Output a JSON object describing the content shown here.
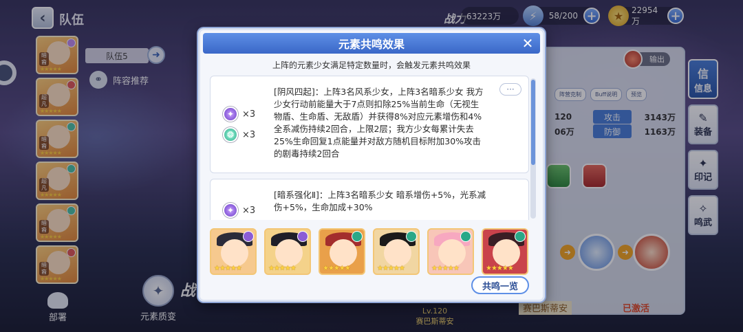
{
  "header": {
    "title": "队伍",
    "power_label": "战力",
    "power_value": "63223万",
    "energy": "58/200",
    "gold": "22954万"
  },
  "team": {
    "name": "队伍5",
    "lineup_recommend": "阵容推荐",
    "element_change": "元素质变",
    "battle": "战",
    "deploy": "部署"
  },
  "roster": [
    {
      "role": "暗裔",
      "color": "#c18cf0"
    },
    {
      "role": "超凡",
      "color": "#e05a5a"
    },
    {
      "role": "暗裔",
      "color": "#4fc3a6"
    },
    {
      "role": "超凡",
      "color": "#4fc3a6"
    },
    {
      "role": "暗裔",
      "color": "#4fc3a6"
    },
    {
      "role": "暗裔",
      "color": "#e05a5a"
    }
  ],
  "modal": {
    "title": "元素共鸣效果",
    "close": "✕",
    "subtitle": "上阵的元素少女满足特定数量时，会触发元素共鸣效果",
    "more": "···",
    "cards": [
      {
        "reqs": [
          {
            "elem": "dark",
            "count": "×3"
          },
          {
            "elem": "wind",
            "count": "×3"
          }
        ],
        "text": "[阴风四起]：上阵3名风系少女，上阵3名暗系少女 我方少女行动前能量大于7点则扣除25%当前生命（无视生物盾、生命盾、无敌盾）并获得8%对应元素增伤和4%全系减伤持续2回合，上限2层；我方少女每累计失去25%生命回复1点能量并对敌方随机目标附加30%攻击的剧毒持续2回合"
      },
      {
        "reqs": [
          {
            "elem": "dark",
            "count": "×3"
          }
        ],
        "text": "[暗系强化Ⅱ]：上阵3名暗系少女 暗系增伤+5%，光系减伤+5%，生命加成+30%"
      }
    ],
    "resonance_button": "共鸣一览"
  },
  "lineup": [
    {
      "el": "dark",
      "hat": "#2b2b3a",
      "bg": "#f6c98e"
    },
    {
      "el": "dark",
      "hat": "#1e1e28",
      "bg": "#f4d28a"
    },
    {
      "el": "wind",
      "hat": "#a32d2d",
      "bg": "#e9a04a"
    },
    {
      "el": "wind",
      "hat": "#1a1a1a",
      "bg": "#f1d6a2"
    },
    {
      "el": "wind",
      "hat": "#f7a8c0",
      "bg": "#f8c6b8"
    },
    {
      "el": "wind",
      "hat": "#3a1e24",
      "bg": "#c9434b"
    }
  ],
  "right_panel": {
    "output": "输出",
    "tabs": [
      "阵营克制",
      "Buff说明",
      "预览"
    ],
    "stats": [
      {
        "pre": "120",
        "label": "攻击",
        "value": "3143万"
      },
      {
        "pre": "06万",
        "label": "防御",
        "value": "1163万"
      }
    ],
    "bottom_name": "赛巴斯蒂安",
    "activated": "已激活",
    "lv": "Lv.120",
    "lv_name": "赛巴斯蒂安"
  },
  "side_tabs": [
    {
      "label": "信息",
      "icon": "信"
    },
    {
      "label": "装备",
      "icon": "✎"
    },
    {
      "label": "印记",
      "icon": "✦"
    },
    {
      "label": "鸣武",
      "icon": "✧"
    }
  ]
}
